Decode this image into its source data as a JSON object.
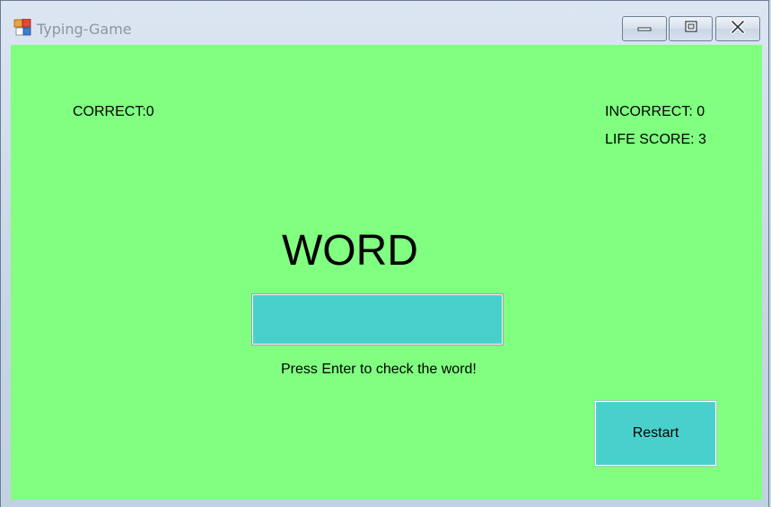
{
  "window": {
    "title": "Typing-Game",
    "app_icon": "windows-form-icon",
    "controls": {
      "minimize_icon": "minimize-icon",
      "maximize_icon": "maximize-icon",
      "close_icon": "close-icon"
    }
  },
  "stats": {
    "correct": "CORRECT:0",
    "incorrect": "INCORRECT: 0",
    "life_score": "LIFE SCORE: 3"
  },
  "game": {
    "word": "WORD",
    "input_value": "",
    "hint": "Press Enter to check the word!",
    "restart_label": "Restart"
  },
  "colors": {
    "background": "#80ff80",
    "controls": "#48d1cc"
  }
}
